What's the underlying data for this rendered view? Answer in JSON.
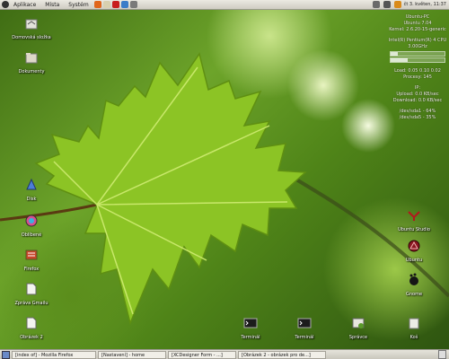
{
  "top_panel": {
    "menus": [
      "Aplikace",
      "Místa",
      "Systém"
    ],
    "clock": "čt 3. květen, 11:37"
  },
  "desktop_icons": {
    "left": [
      "Domovská složka",
      "Dokumenty",
      "Disk",
      "Oblíbené",
      "Firefox",
      "Zpráva Gmailu",
      "Obrázek 2"
    ],
    "bottom": [
      "Terminál",
      "Terminál",
      "Správce",
      "Koš"
    ],
    "right": [
      "Ubuntu Studio",
      "Ubuntu",
      "Gnome"
    ]
  },
  "conky": {
    "host": "Ubuntu-PC",
    "os": "Ubuntu 7.04",
    "kernel": "Kernel: 2.6.20-15-generic",
    "cpu": "Intel(R) Pentium(R) 4 CPU 3.00GHz",
    "cpu_usage": 0.14,
    "ram_usage": 0.32,
    "load": "Load: 0.05 0.10 0.02",
    "processes": "Procesy: 145",
    "ip": "IP:",
    "upload": "Upload: 0.0 KB/sec",
    "download": "Download: 0.0 KB/sec",
    "disk1": "/dev/sda1 - 64%",
    "disk2": "/dev/sda5 - 35%"
  },
  "taskbar": [
    "[index of] - Mozilla Firefox",
    "[Nastavení] - home",
    "[XCDesigner Form - ...]",
    "[Obrázek 2 - obrázek pro de...]"
  ]
}
